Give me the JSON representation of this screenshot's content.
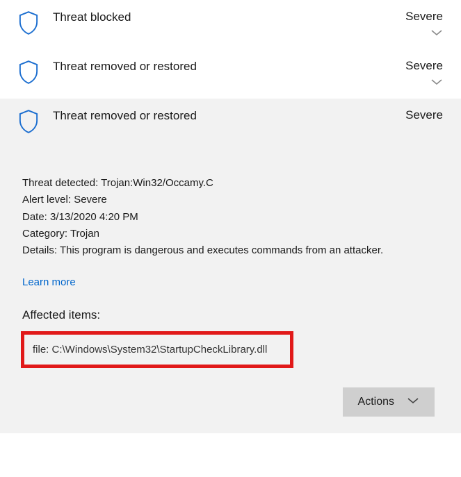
{
  "threats": [
    {
      "title": "Threat blocked",
      "severity": "Severe"
    },
    {
      "title": "Threat removed or restored",
      "severity": "Severe"
    },
    {
      "title": "Threat removed or restored",
      "severity": "Severe"
    }
  ],
  "expanded": {
    "detected_label": "Threat detected:",
    "detected_value": "Trojan:Win32/Occamy.C",
    "alert_label": "Alert level:",
    "alert_value": "Severe",
    "date_label": "Date:",
    "date_value": "3/13/2020 4:20 PM",
    "category_label": "Category:",
    "category_value": "Trojan",
    "details_label": "Details:",
    "details_value": "This program is dangerous and executes commands from an attacker.",
    "learn_more": "Learn more",
    "affected_heading": "Affected items:",
    "affected_item": "file: C:\\Windows\\System32\\StartupCheckLibrary.dll",
    "actions_label": "Actions"
  }
}
